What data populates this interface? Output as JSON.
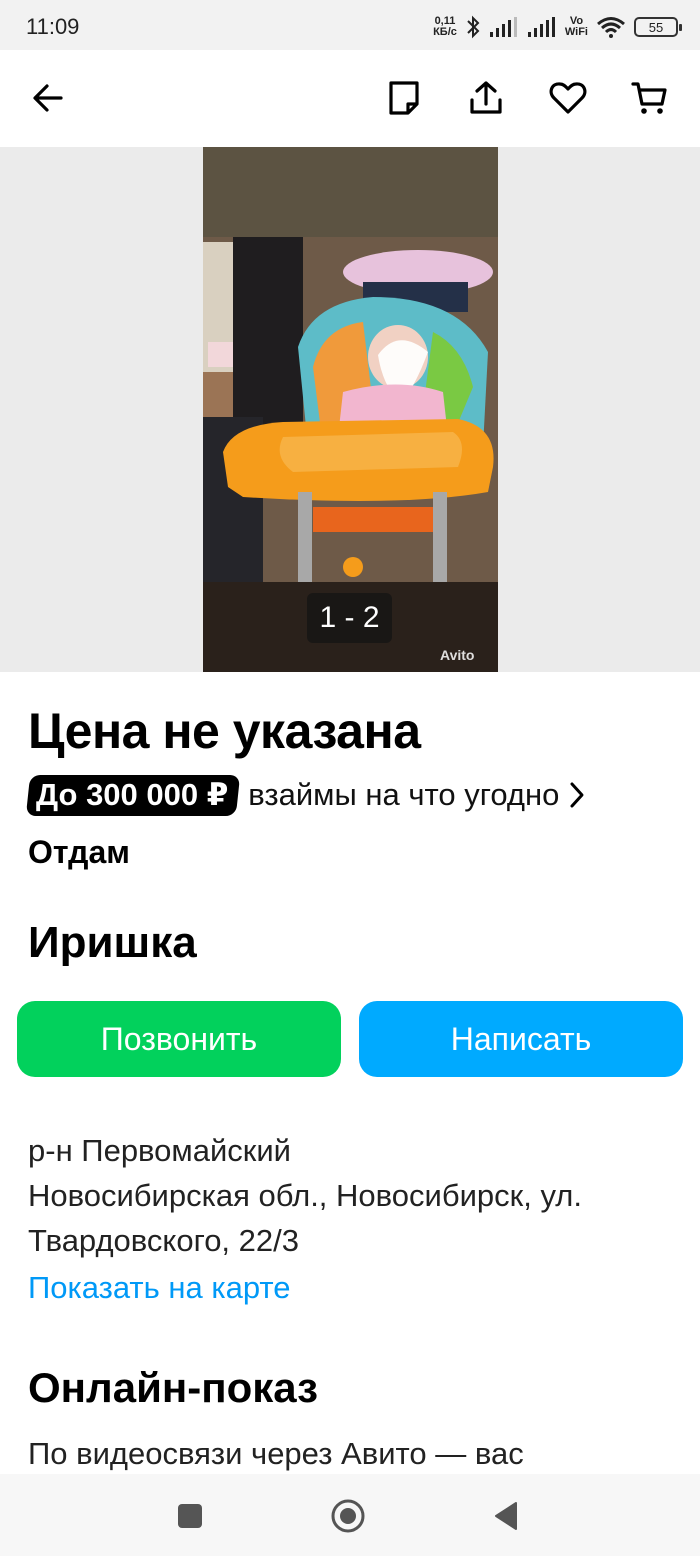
{
  "status_bar": {
    "time": "11:09",
    "net_speed_value": "0,11",
    "net_speed_unit": "КБ/с",
    "vowifi_top": "Vo",
    "vowifi_bottom": "WiFi",
    "battery": "55"
  },
  "app_bar": {
    "icons": [
      "back-arrow-icon",
      "note-icon",
      "share-icon",
      "favorite-heart-icon",
      "cart-icon"
    ]
  },
  "gallery": {
    "counter": "1 - 2",
    "watermark": "Avito"
  },
  "listing": {
    "price": "Цена не указана",
    "promo_badge": "До 300 000 ₽",
    "promo_text": "взаймы на что угодно",
    "deal_type": "Отдам",
    "seller_name": "Иришка"
  },
  "actions": {
    "call_label": "Позвонить",
    "write_label": "Написать"
  },
  "location": {
    "district": "р-н Первомайский",
    "address_line1": "Новосибирская обл., Новосибирск, ул.",
    "address_line2": "Твардовского, 22/3",
    "map_link": "Показать на карте"
  },
  "online_show": {
    "title": "Онлайн-показ",
    "text": "По видеосвязи через Авито — вас"
  },
  "colors": {
    "call_button": "#02d15c",
    "write_button": "#00aaff",
    "link": "#0099f7"
  }
}
